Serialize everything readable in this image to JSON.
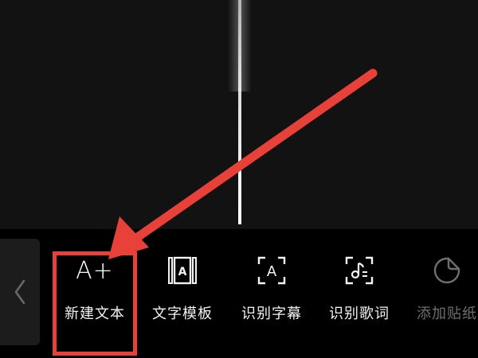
{
  "colors": {
    "background": "#000000",
    "timeline_bg": "#121212",
    "panel_bg": "#1c1c1c",
    "label": "#f2f2f2",
    "label_dim": "#6e6e6e",
    "annotation": "#e8413a"
  },
  "nav": {
    "back_icon": "chevron-left-icon"
  },
  "tools": [
    {
      "label": "新建文本",
      "icon": "a-plus-icon",
      "glyph": "A+",
      "highlighted": true
    },
    {
      "label": "文字模板",
      "icon": "text-template-icon"
    },
    {
      "label": "识别字幕",
      "icon": "recognize-subtitle-icon",
      "glyph": "A"
    },
    {
      "label": "识别歌词",
      "icon": "recognize-lyrics-icon"
    },
    {
      "label": "添加贴纸",
      "icon": "sticker-icon",
      "dimmed": true
    }
  ]
}
